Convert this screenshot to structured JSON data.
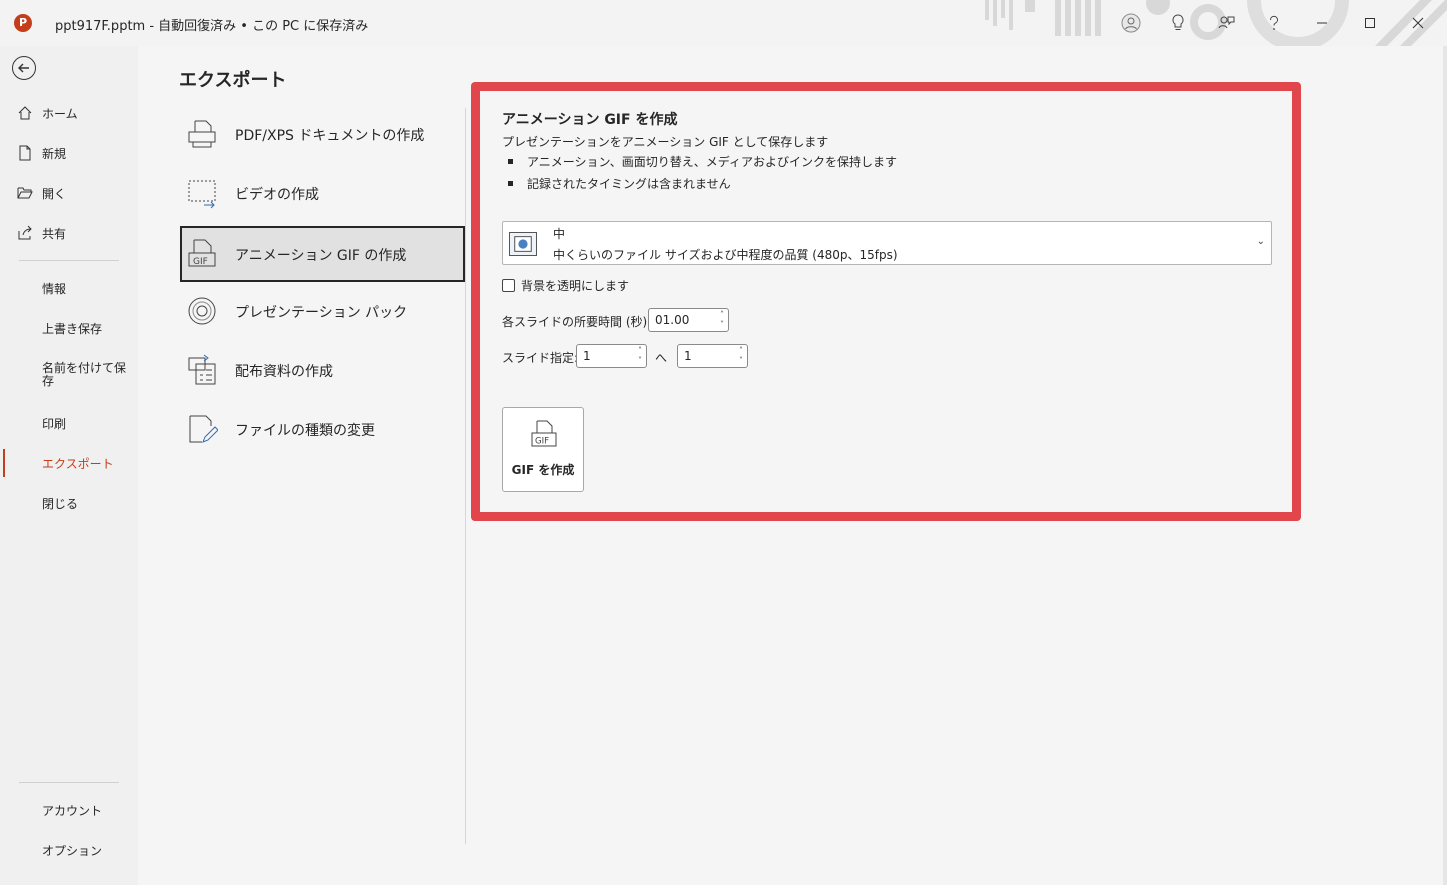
{
  "window": {
    "app_icon": "powerpoint-icon",
    "app_icon_letter": "P",
    "title": "ppt917F.pptm  -  自動回復済み • この PC に保存済み"
  },
  "nav": {
    "top_items": [
      {
        "label": "ホーム",
        "icon": "home-icon"
      },
      {
        "label": "新規",
        "icon": "new-document-icon"
      },
      {
        "label": "開く",
        "icon": "open-folder-icon"
      },
      {
        "label": "共有",
        "icon": "share-icon"
      }
    ],
    "items": {
      "info": "情報",
      "save": "上書き保存",
      "save_as": "名前を付けて保存",
      "print": "印刷",
      "export": "エクスポート",
      "close": "閉じる"
    },
    "bottom": {
      "account": "アカウント",
      "options": "オプション"
    }
  },
  "main": {
    "title": "エクスポート",
    "options": [
      {
        "label": "PDF/XPS ドキュメントの作成",
        "icon": "pdf-document-icon"
      },
      {
        "label": "ビデオの作成",
        "icon": "video-icon"
      },
      {
        "label": "アニメーション GIF の作成",
        "icon": "gif-icon"
      },
      {
        "label": "プレゼンテーション パック",
        "icon": "cd-package-icon"
      },
      {
        "label": "配布資料の作成",
        "icon": "handout-icon"
      },
      {
        "label": "ファイルの種類の変更",
        "icon": "file-type-change-icon"
      }
    ]
  },
  "panel": {
    "title": "アニメーション GIF を作成",
    "description": "プレゼンテーションをアニメーション GIF として保存します",
    "bullets": [
      "アニメーション、画面切り替え、メディアおよびインクを保持します",
      "記録されたタイミングは含まれません"
    ],
    "quality": {
      "name": "中",
      "detail": "中くらいのファイル サイズおよび中程度の品質 (480p、15fps)"
    },
    "transparent_label": "背景を透明にします",
    "duration_label": "各スライドの所要時間 (秒):",
    "duration_value": "01.00",
    "slides_label": "スライド指定:",
    "slide_from": "1",
    "slide_to_sep": "へ",
    "slide_to": "1",
    "create_button": "GIF を作成"
  },
  "colors": {
    "accent": "#c43e1c",
    "highlight": "#e0464c"
  }
}
